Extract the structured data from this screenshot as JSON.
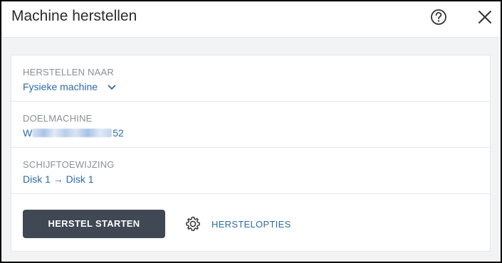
{
  "dialog": {
    "title": "Machine herstellen",
    "help_icon": "help-circle-icon",
    "close_icon": "close-icon"
  },
  "rows": [
    {
      "label": "HERSTELLEN NAAR",
      "value": "Fysieke machine",
      "icon": "chevron-down-icon"
    },
    {
      "label": "DOELMACHINE",
      "value_prefix": "W",
      "value_suffix": "52"
    },
    {
      "label": "SCHIJFTOEWIJZING",
      "value": "Disk 1 → Disk 1"
    }
  ],
  "actions": {
    "start_label": "HERSTEL STARTEN",
    "options_label": "HERSTELOPTIES",
    "options_icon": "gear-icon"
  },
  "colors": {
    "link": "#2d6aa8",
    "button_bg": "#404854",
    "label": "#8a8f96",
    "panel_bg": "#f2f3f5"
  }
}
